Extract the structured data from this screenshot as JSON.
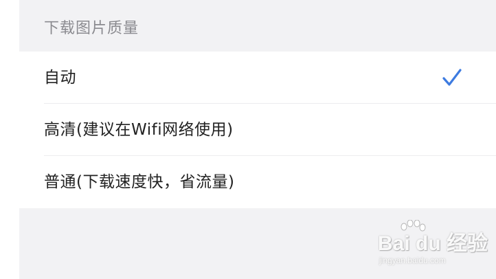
{
  "section": {
    "title": "下载图片质量"
  },
  "options": [
    {
      "label": "自动",
      "selected": true
    },
    {
      "label": "高清(建议在Wifi网络使用)",
      "selected": false
    },
    {
      "label": "普通(下载速度快，省流量)",
      "selected": false
    }
  ],
  "check_icon": "checkmark-icon",
  "colors": {
    "accent": "#3d7be0",
    "background": "#f2f2f4",
    "card": "#ffffff",
    "header_text": "#8a8a8f",
    "item_text": "#222222"
  },
  "watermark": {
    "logo": "Bai du 经验",
    "url": "jingyan.baidu.com"
  }
}
